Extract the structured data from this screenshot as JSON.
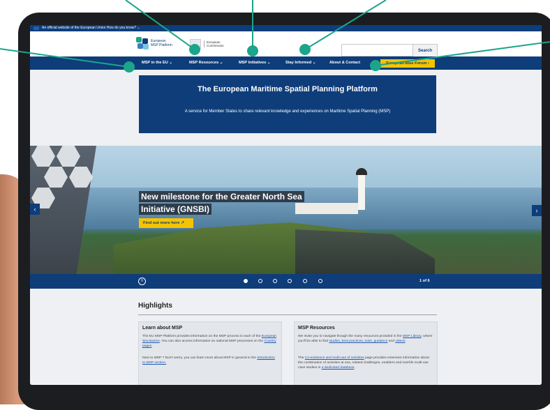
{
  "eu_bar": {
    "text": "An official website of the European Union   How do you know? ⌄"
  },
  "header": {
    "msp_logo_text_1": "European",
    "msp_logo_text_2": "MSP Platform",
    "ec_logo_text_1": "European",
    "ec_logo_text_2": "Commission",
    "search_placeholder": "",
    "search_button": "Search"
  },
  "nav": {
    "items": [
      "MSP in the EU  ⌄",
      "MSP Resources  ⌄",
      "MSP Initiatives  ⌄",
      "Stay Informed  ⌄",
      "About & Contact"
    ],
    "cta": "European Blue Forum ›"
  },
  "banner": {
    "title": "The European Maritime Spatial Planning Platform",
    "subtitle": "A service for Member States to share relevant knowledge and experiences on Maritime Spatial Planning (MSP)"
  },
  "hero": {
    "title": "New milestone for the Greater North Sea Initiative (GNSBI)",
    "button": "Find out more here ↗",
    "prev": "‹",
    "next": "›"
  },
  "carousel": {
    "pause": "II",
    "slides": 6,
    "active": 1,
    "counter": "1 of 6"
  },
  "highlights": {
    "title": "Highlights",
    "cards": [
      {
        "title": "Learn about MSP",
        "p1_a": "The EU MSP Platform provides information on the MSP process in each of the ",
        "p1_link1": "European Sea Basins",
        "p1_b": ". You can also access information on national MSP processes on the ",
        "p1_link2": "Country pages",
        "p1_c": ".",
        "p2_a": "New to MSP ? Don't worry, you can learn more about MSP in general in the ",
        "p2_link": "Introduction to MSP section."
      },
      {
        "title": "MSP Resources",
        "p1_a": "We invite you to navigate though the many resources provided in the ",
        "p1_link1": "MSP Library",
        "p1_b": ", where you'll be able to find ",
        "p1_link2": "studies, best practices, tools, guidance",
        "p1_c": " and ",
        "p1_link3": "videos",
        "p1_d": ".",
        "p2_a": "The ",
        "p2_link1": "Co-existence and multi-use of activities",
        "p2_b": " page provides extensive information about the combination of activities at sea, related challenges, enablers and real-life multi-use case studies in ",
        "p2_link2": "a dedicated database",
        "p2_c": "."
      }
    ]
  },
  "colors": {
    "eu_blue": "#0e3d7a",
    "accent_yellow": "#f5c400",
    "callout_teal": "#1ba58a",
    "tablet_frame": "#1b1d21"
  }
}
